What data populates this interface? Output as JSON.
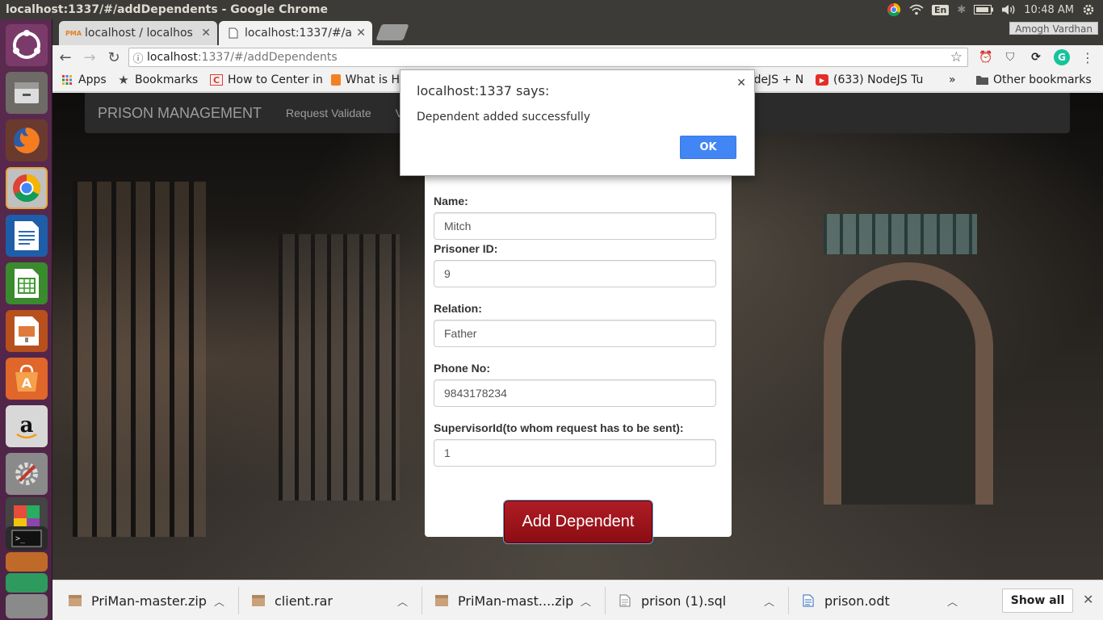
{
  "system": {
    "window_title": "localhost:1337/#/addDependents - Google Chrome",
    "lang": "En",
    "clock": "10:48 AM",
    "user": "Amogh Vardhan"
  },
  "tabs": [
    {
      "label": "localhost / localhos",
      "favicon": "phpmyadmin-icon",
      "active": false
    },
    {
      "label": "localhost:1337/#/a",
      "favicon": "page-icon",
      "active": true
    }
  ],
  "omnibox": {
    "host": "localhost",
    "path": ":1337/#/addDependents"
  },
  "bookmarks": [
    {
      "label": "Apps",
      "icon": "apps-grid-icon"
    },
    {
      "label": "Bookmarks",
      "icon": "star-icon"
    },
    {
      "label": "How to Center in",
      "icon": "c-icon"
    },
    {
      "label": "What is H",
      "icon": "stack-icon"
    },
    {
      "label": "odeJS + N",
      "icon": ""
    },
    {
      "label": "(633) NodeJS Tu",
      "icon": "youtube-icon"
    },
    {
      "label": "Other bookmarks",
      "icon": "folder-icon"
    }
  ],
  "navbar": {
    "brand": "PRISON MANAGEMENT",
    "link1": "Request Validate",
    "link2": "V"
  },
  "form": {
    "name_label": "Name:",
    "name_value": "Mitch",
    "pid_label": "Prisoner ID:",
    "pid_value": "9",
    "relation_label": "Relation:",
    "relation_value": "Father",
    "phone_label": "Phone No:",
    "phone_value": "9843178234",
    "sup_label": "SupervisorId(to whom request has to be sent):",
    "sup_value": "1",
    "submit_label": "Add Dependent"
  },
  "alert": {
    "title": "localhost:1337 says:",
    "message": "Dependent added successfully",
    "ok_label": "OK"
  },
  "downloads": [
    {
      "name": "PriMan-master.zip",
      "icon": "archive-icon"
    },
    {
      "name": "client.rar",
      "icon": "archive-icon"
    },
    {
      "name": "PriMan-mast....zip",
      "icon": "archive-icon"
    },
    {
      "name": "prison (1).sql",
      "icon": "text-file-icon"
    },
    {
      "name": "prison.odt",
      "icon": "document-icon"
    }
  ],
  "shelf": {
    "show_all": "Show all"
  },
  "colors": {
    "accent": "#4285f4",
    "submit": "#9b121a",
    "navbar": "#2b2b2b",
    "launcher": "#4c2345"
  }
}
